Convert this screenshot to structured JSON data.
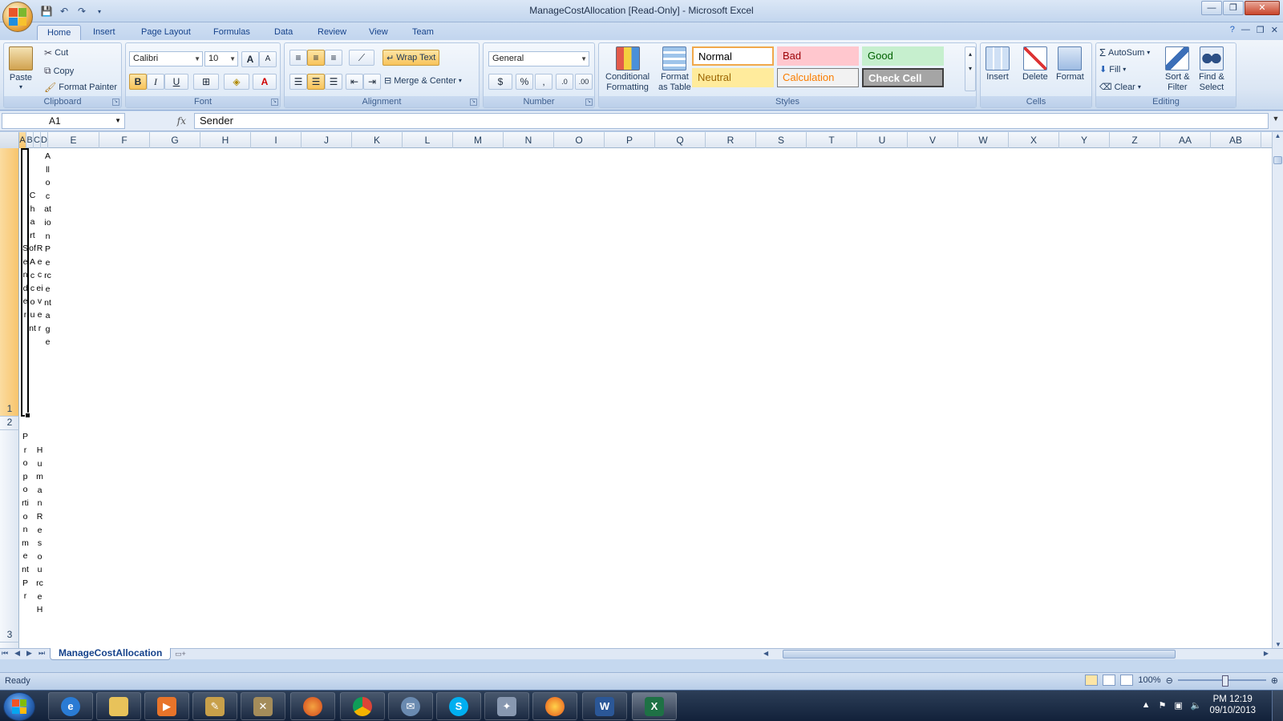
{
  "window": {
    "title": "ManageCostAllocation  [Read-Only] - Microsoft Excel",
    "qat_icons": [
      "save-icon",
      "undo-icon",
      "redo-icon",
      "customize-qat-icon"
    ]
  },
  "ribbon_tabs": [
    "Home",
    "Insert",
    "Page Layout",
    "Formulas",
    "Data",
    "Review",
    "View",
    "Team"
  ],
  "ribbon": {
    "clipboard": {
      "label": "Clipboard",
      "paste": "Paste",
      "cut": "Cut",
      "copy": "Copy",
      "format_painter": "Format Painter"
    },
    "font": {
      "label": "Font",
      "font_name": "Calibri",
      "font_size": "10",
      "grow": "A",
      "shrink": "A",
      "bold": "B",
      "italic": "I",
      "underline": "U",
      "font_color": "A"
    },
    "alignment": {
      "label": "Alignment",
      "wrap_text": "Wrap Text",
      "merge_center": "Merge & Center"
    },
    "number": {
      "label": "Number",
      "format": "General",
      "percent": "%",
      "comma": ",",
      "inc_decimal": ".0",
      "dec_decimal": ".00"
    },
    "styles": {
      "label": "Styles",
      "conditional_formatting_line1": "Conditional",
      "conditional_formatting_line2": "Formatting",
      "format_table_line1": "Format",
      "format_table_line2": "as Table",
      "cells": [
        {
          "name": "Normal",
          "bg": "#ffffff",
          "fg": "#000000",
          "border": "#f0a84a"
        },
        {
          "name": "Bad",
          "bg": "#ffc7ce",
          "fg": "#9c0006",
          "border": "#ffc7ce"
        },
        {
          "name": "Good",
          "bg": "#c6efce",
          "fg": "#006100",
          "border": "#c6efce"
        },
        {
          "name": "Neutral",
          "bg": "#ffeb9c",
          "fg": "#9c6500",
          "border": "#ffeb9c"
        },
        {
          "name": "Calculation",
          "bg": "#f2f2f2",
          "fg": "#fa7d00",
          "border": "#7f7f7f"
        },
        {
          "name": "Check Cell",
          "bg": "#a5a5a5",
          "fg": "#ffffff",
          "border": "#3f3f3f"
        }
      ]
    },
    "cells": {
      "label": "Cells",
      "insert": "Insert",
      "delete": "Delete",
      "format": "Format"
    },
    "editing": {
      "label": "Editing",
      "autosum": "AutoSum",
      "fill": "Fill",
      "clear": "Clear",
      "sort_line1": "Sort &",
      "sort_line2": "Filter",
      "find_line1": "Find &",
      "find_line2": "Select"
    }
  },
  "formula_bar": {
    "name_box": "A1",
    "fx": "fx",
    "content": "Sender"
  },
  "columns": [
    "A",
    "B",
    "C",
    "D",
    "E",
    "F",
    "G",
    "H",
    "I",
    "J",
    "K",
    "L",
    "M",
    "N",
    "O",
    "P",
    "Q",
    "R",
    "S",
    "T",
    "U",
    "V",
    "W",
    "X",
    "Y",
    "Z",
    "AA",
    "AB"
  ],
  "rows": [
    "1",
    "2",
    "3"
  ],
  "cells": {
    "A1": "Sender",
    "B1": "Chart of Account",
    "C1": "Receiver",
    "D1": "Allocation Percentage",
    "A3": "Proportionment Pr",
    "C3": "Human Resource H"
  },
  "sheet": {
    "tab": "ManageCostAllocation"
  },
  "status": {
    "text": "Ready",
    "zoom": "100%"
  },
  "taskbar": {
    "apps": [
      "Internet Explorer",
      "Windows Explorer",
      "Media Player",
      "Paint",
      "Tools",
      "Firefox",
      "Chrome",
      "Thunderbird",
      "Skype",
      "App",
      "Burner",
      "Word",
      "Excel"
    ],
    "time": "PM 12:19",
    "date": "09/10/2013"
  },
  "colors": {
    "accent": "#15428b",
    "selection": "#f8c46c"
  }
}
